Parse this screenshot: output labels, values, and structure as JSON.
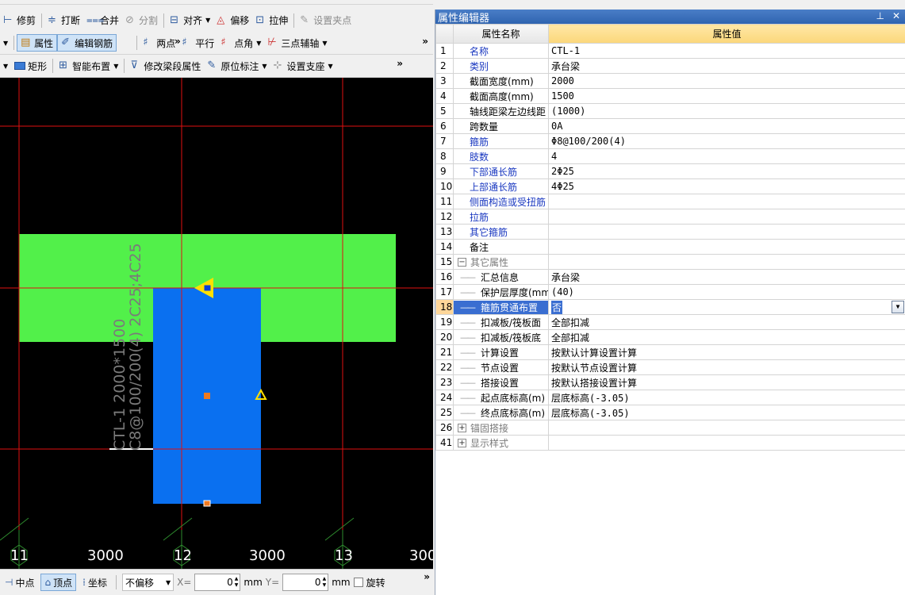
{
  "toolbar_row1": {
    "items": [
      "修剪",
      "打断",
      "合并",
      "分割",
      "对齐",
      "偏移",
      "拉伸",
      "设置夹点"
    ]
  },
  "toolbar_row2": {
    "items": [
      "属性",
      "编辑钢筋",
      "两点",
      "平行",
      "点角",
      "三点辅轴"
    ]
  },
  "toolbar_row3": {
    "items": [
      "矩形",
      "智能布置",
      "修改梁段属性",
      "原位标注",
      "设置支座"
    ]
  },
  "canvas": {
    "beam_label_line1": "CTL-1 2000*1500",
    "beam_label_line2": "C8@100/200(4) 2C25;4C25",
    "axis_labels": [
      "11",
      "12",
      "13"
    ],
    "dimension_labels": [
      "3000",
      "3000",
      "300"
    ]
  },
  "statusbar": {
    "midpoint": "中点",
    "vertex": "顶点",
    "coord": "坐标",
    "offset_mode": "不偏移",
    "x_label": "X=",
    "x_value": "0",
    "y_label": "Y=",
    "y_value": "0",
    "unit": "mm",
    "rotate": "旋转"
  },
  "prop_editor": {
    "title": "属性编辑器",
    "header_name": "属性名称",
    "header_value": "属性值",
    "rows": [
      {
        "num": "1",
        "name": "名称",
        "value": "CTL-1",
        "style": "blue"
      },
      {
        "num": "2",
        "name": "类别",
        "value": "承台梁",
        "style": "blue"
      },
      {
        "num": "3",
        "name": "截面宽度(mm)",
        "value": "2000",
        "style": "normal"
      },
      {
        "num": "4",
        "name": "截面高度(mm)",
        "value": "1500",
        "style": "normal"
      },
      {
        "num": "5",
        "name": "轴线距梁左边线距",
        "value": "(1000)",
        "style": "normal"
      },
      {
        "num": "6",
        "name": "跨数量",
        "value": "0A",
        "style": "normal"
      },
      {
        "num": "7",
        "name": "箍筋",
        "value": "Φ8@100/200(4)",
        "style": "blue"
      },
      {
        "num": "8",
        "name": "肢数",
        "value": "4",
        "style": "blue"
      },
      {
        "num": "9",
        "name": "下部通长筋",
        "value": "2Φ25",
        "style": "blue"
      },
      {
        "num": "10",
        "name": "上部通长筋",
        "value": "4Φ25",
        "style": "blue"
      },
      {
        "num": "11",
        "name": "侧面构造或受扭筋",
        "value": "",
        "style": "blue"
      },
      {
        "num": "12",
        "name": "拉筋",
        "value": "",
        "style": "blue"
      },
      {
        "num": "13",
        "name": "其它箍筋",
        "value": "",
        "style": "blue"
      },
      {
        "num": "14",
        "name": "备注",
        "value": "",
        "style": "normal"
      },
      {
        "num": "15",
        "name": "其它属性",
        "value": "",
        "style": "group-open"
      },
      {
        "num": "16",
        "name": "汇总信息",
        "value": "承台梁",
        "style": "child"
      },
      {
        "num": "17",
        "name": "保护层厚度(mm)",
        "value": "(40)",
        "style": "child"
      },
      {
        "num": "18",
        "name": "箍筋贯通布置",
        "value": "否",
        "style": "child-selected"
      },
      {
        "num": "19",
        "name": "扣减板/筏板面",
        "value": "全部扣减",
        "style": "child"
      },
      {
        "num": "20",
        "name": "扣减板/筏板底",
        "value": "全部扣减",
        "style": "child"
      },
      {
        "num": "21",
        "name": "计算设置",
        "value": "按默认计算设置计算",
        "style": "child"
      },
      {
        "num": "22",
        "name": "节点设置",
        "value": "按默认节点设置计算",
        "style": "child"
      },
      {
        "num": "23",
        "name": "搭接设置",
        "value": "按默认搭接设置计算",
        "style": "child"
      },
      {
        "num": "24",
        "name": "起点底标高(m)",
        "value": "层底标高(-3.05)",
        "style": "child"
      },
      {
        "num": "25",
        "name": "终点底标高(m)",
        "value": "层底标高(-3.05)",
        "style": "child"
      },
      {
        "num": "26",
        "name": "锚固搭接",
        "value": "",
        "style": "group-closed"
      },
      {
        "num": "41",
        "name": "显示样式",
        "value": "",
        "style": "group-closed"
      }
    ]
  },
  "colors": {
    "canvas_bg": "#000000",
    "grid_red": "#e01010",
    "beam_green": "#52f04a",
    "pile_blue": "#0a70f0",
    "marker_yellow": "#ffe000",
    "marker_orange": "#f07a20",
    "axis_green": "#2e8b2e"
  }
}
